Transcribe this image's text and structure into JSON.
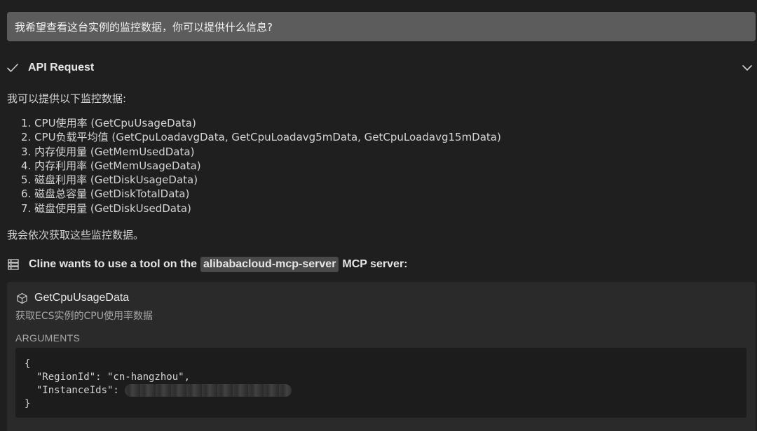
{
  "user_message": "我希望查看这台实例的监控数据，你可以提供什么信息?",
  "api_request": {
    "status": "check-icon",
    "label": "API Request",
    "expand": "chevron-down-icon"
  },
  "assistant": {
    "intro": "我可以提供以下监控数据:",
    "items": [
      "1. CPU使用率 (GetCpuUsageData)",
      "2. CPU负载平均值 (GetCpuLoadavgData, GetCpuLoadavg5mData, GetCpuLoadavg15mData)",
      "3. 内存使用量 (GetMemUsedData)",
      "4. 内存利用率 (GetMemUsageData)",
      "5. 磁盘利用率 (GetDiskUsageData)",
      "6. 磁盘总容量 (GetDiskTotalData)",
      "7. 磁盘使用量 (GetDiskUsedData)"
    ],
    "closing": "我会依次获取这些监控数据。"
  },
  "tool_use": {
    "prefix": "Cline wants to use a tool on the",
    "server": "alibabacloud-mcp-server",
    "suffix": "MCP server:"
  },
  "tool": {
    "icon": "box-icon",
    "name": "GetCpuUsageData",
    "description": "获取ECS实例的CPU使用率数据",
    "arguments_label": "ARGUMENTS",
    "code": {
      "open": "{",
      "region_line": "  \"RegionId\": \"cn-hangzhou\",",
      "instance_key": "  \"InstanceIds\":",
      "close": "}"
    }
  },
  "colors": {
    "background": "#1f1f1f",
    "user_bubble": "#5c5c5c",
    "card": "#2a2a2a",
    "code_bg": "#1c1c1c",
    "pill": "#4a4a4a"
  }
}
